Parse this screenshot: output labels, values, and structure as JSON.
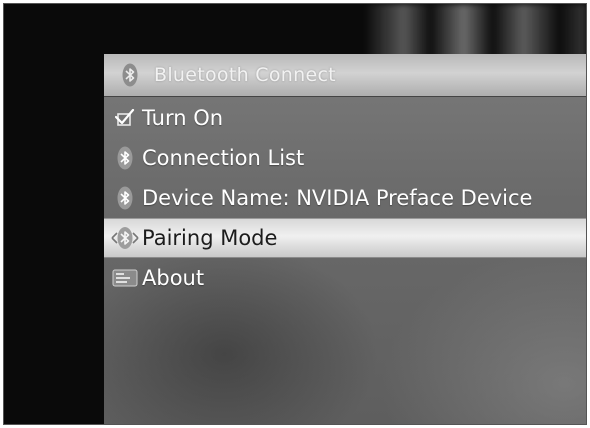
{
  "title_bar": {
    "title": "Bluetooth Connect",
    "icon": "bluetooth-icon"
  },
  "menu": {
    "items": [
      {
        "label": "Turn On",
        "icon": "checkbox-checked-icon"
      },
      {
        "label": "Connection List",
        "icon": "bluetooth-icon"
      },
      {
        "label": "Device Name: NVIDIA Preface Device",
        "icon": "bluetooth-icon"
      },
      {
        "label": "Pairing Mode",
        "icon": "bluetooth-pairing-icon",
        "selected": true
      },
      {
        "label": "About",
        "icon": "info-icon"
      }
    ]
  }
}
